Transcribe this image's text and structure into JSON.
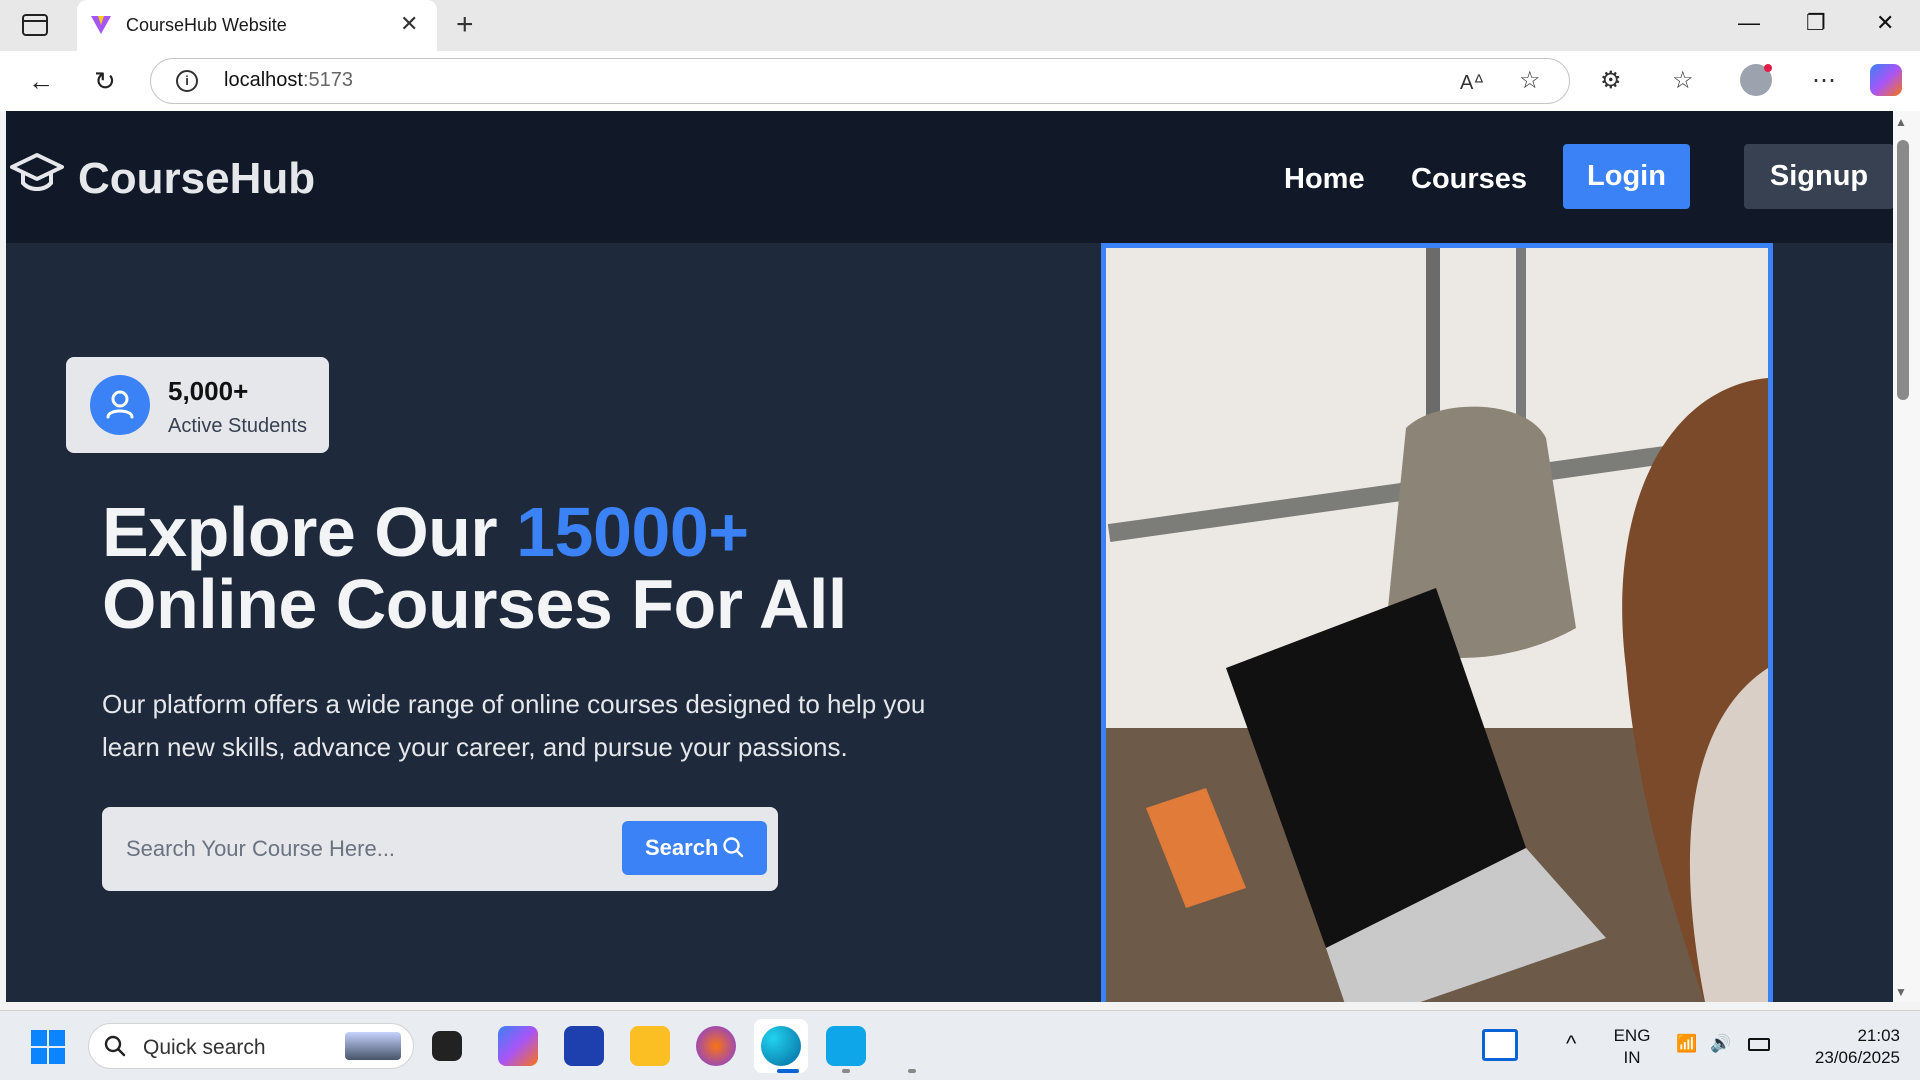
{
  "browser": {
    "tab_title": "CourseHub Website",
    "tab_close": "✕",
    "new_tab": "+",
    "url_host": "localhost",
    "url_port": ":5173",
    "controls": {
      "minimize": "—",
      "restore": "❐",
      "close": "✕"
    }
  },
  "site": {
    "brand": "CourseHub",
    "nav": {
      "home": "Home",
      "courses": "Courses",
      "login": "Login",
      "signup": "Signup"
    },
    "stat": {
      "number": "5,000+",
      "label": "Active Students"
    },
    "hero": {
      "title_part1": "Explore Our ",
      "title_accent": "15000+",
      "title_part2": "Online Courses For All",
      "description": "Our platform offers a wide range of online courses designed to help you learn new skills, advance your career, and pursue your passions."
    },
    "search": {
      "placeholder": "Search Your Course Here...",
      "button": "Search"
    }
  },
  "taskbar": {
    "search_text": "Quick search",
    "lang_top": "ENG",
    "lang_bottom": "IN",
    "time": "21:03",
    "date": "23/06/2025",
    "chevron": "^"
  },
  "colors": {
    "accent": "#3b82f6",
    "nav_bg": "#111827",
    "hero_bg": "#1e293b",
    "signup_bg": "#374151"
  }
}
